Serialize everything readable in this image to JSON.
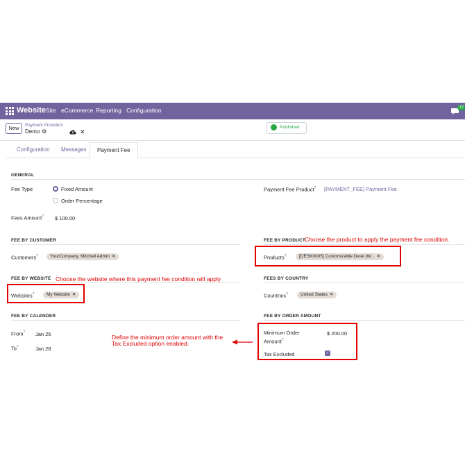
{
  "navbar": {
    "brand": "Website",
    "menu": [
      "Site",
      "eCommerce",
      "Reporting",
      "Configuration"
    ],
    "chat_badge": "12"
  },
  "control_panel": {
    "new_label": "New",
    "breadcrumb": "Payment Providers",
    "record_name": "Demo",
    "published_label": "Published"
  },
  "tabs": [
    "Configuration",
    "Messages",
    "Payment Fee"
  ],
  "general": {
    "title": "GENERAL",
    "fee_type_label": "Fee Type",
    "fee_type_options": [
      "Fixed Amount",
      "Order Percentage"
    ],
    "fee_type_selected": "Fixed Amount",
    "fees_amount_label": "Fees Amount",
    "fees_amount_value": "$ 100.00",
    "payment_fee_product_label": "Payment Fee Product",
    "payment_fee_product_value": "[PAYMENT_FEE] Payment Fee"
  },
  "fee_by_customer": {
    "title": "FEE BY CUSTOMER",
    "customers_label": "Customers",
    "customers_tag": "YourCompany, Mitchell Admin"
  },
  "fee_by_product": {
    "title": "FEE BY PRODUCT",
    "products_label": "Products",
    "products_tag": "[DESK0005] Customizable Desk (W..."
  },
  "fee_by_website": {
    "title": "FEE BY WEBSITE",
    "websites_label": "Websites",
    "websites_tag": "My Website"
  },
  "fee_by_country": {
    "title": "FEES BY COUNTRY",
    "countries_label": "Countries",
    "countries_tag": "United States"
  },
  "fee_by_calender": {
    "title": "FEE BY CALENDER",
    "from_label": "From",
    "from_value": "Jan 26",
    "to_label": "To",
    "to_value": "Jan 28"
  },
  "fee_by_order_amount": {
    "title": "FEE BY ORDER AMOUNT",
    "min_label_line1": "Minimum Order",
    "min_label_line2": "Amount",
    "min_value": "$ 200.00",
    "tax_excluded_label": "Tax Excluded",
    "tax_excluded_checked": true
  },
  "annotations": {
    "product_note": "Choose the product to apply the payment fee condition.",
    "website_note": "Choose the website where this payment fee condition will apply",
    "order_amount_note_line1": "Define the minimum order amount with the",
    "order_amount_note_line2": "Tax Excluded option enabled."
  },
  "colors": {
    "brand": "#71639e",
    "annotation": "#e00000",
    "published": "#28a745",
    "tag_bg": "#e3dcd6"
  }
}
